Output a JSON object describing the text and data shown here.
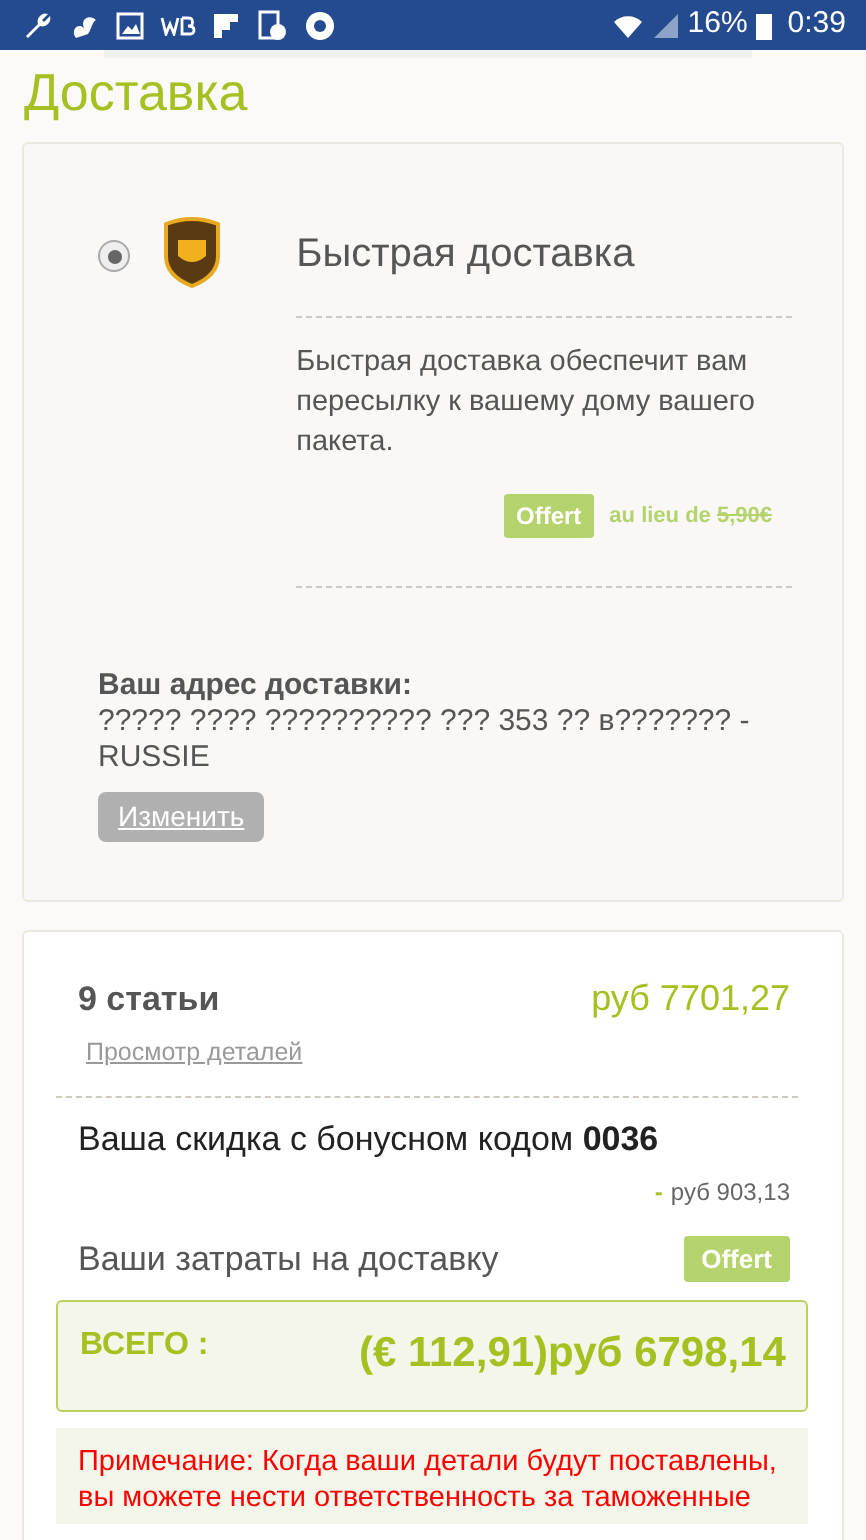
{
  "status_bar": {
    "battery": "16%",
    "time": "0:39"
  },
  "title": "Доставка",
  "shipping_option": {
    "selected": true,
    "name": "Быстрая доставка",
    "description": "Быстрая доставка обеспечит вам пересылку к вашему дому вашего пакета.",
    "badge": "Offert",
    "price_note": "au lieu de",
    "old_price": "5,90€"
  },
  "address": {
    "label": "Ваш адрес доставки:",
    "text": "????? ???? ?????????? ??? 353 ?? в??????? - RUSSIE",
    "button": "Изменить"
  },
  "summary": {
    "items": "9 статьи",
    "items_price": "руб 7701,27",
    "details_link": "Просмотр деталей",
    "discount": {
      "text": "Ваша скидка с бонусном кодом **0036**",
      "sign": "-",
      "amount": "руб 903,13"
    },
    "shipping": {
      "label": "Ваши затраты на доставку",
      "badge": "Offert"
    },
    "total": {
      "label": "ВСЕГО :",
      "amount": "(€ 112,91)руб 6798,14"
    },
    "note": "Примечание: Когда ваши детали будут поставлены, вы можете нести ответственность за таможенные"
  }
}
